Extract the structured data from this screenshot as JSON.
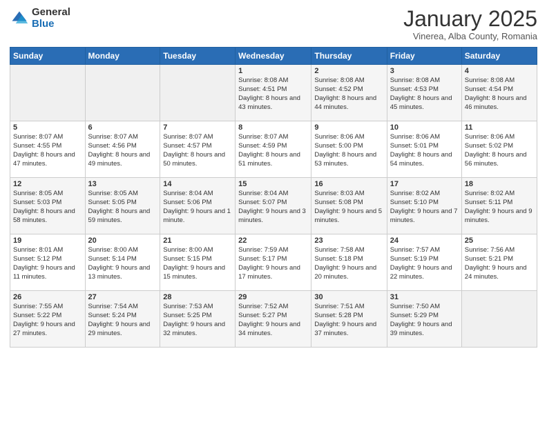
{
  "header": {
    "logo_general": "General",
    "logo_blue": "Blue",
    "month": "January 2025",
    "location": "Vinerea, Alba County, Romania"
  },
  "weekdays": [
    "Sunday",
    "Monday",
    "Tuesday",
    "Wednesday",
    "Thursday",
    "Friday",
    "Saturday"
  ],
  "weeks": [
    [
      {
        "day": "",
        "sunrise": "",
        "sunset": "",
        "daylight": ""
      },
      {
        "day": "",
        "sunrise": "",
        "sunset": "",
        "daylight": ""
      },
      {
        "day": "",
        "sunrise": "",
        "sunset": "",
        "daylight": ""
      },
      {
        "day": "1",
        "sunrise": "Sunrise: 8:08 AM",
        "sunset": "Sunset: 4:51 PM",
        "daylight": "Daylight: 8 hours and 43 minutes."
      },
      {
        "day": "2",
        "sunrise": "Sunrise: 8:08 AM",
        "sunset": "Sunset: 4:52 PM",
        "daylight": "Daylight: 8 hours and 44 minutes."
      },
      {
        "day": "3",
        "sunrise": "Sunrise: 8:08 AM",
        "sunset": "Sunset: 4:53 PM",
        "daylight": "Daylight: 8 hours and 45 minutes."
      },
      {
        "day": "4",
        "sunrise": "Sunrise: 8:08 AM",
        "sunset": "Sunset: 4:54 PM",
        "daylight": "Daylight: 8 hours and 46 minutes."
      }
    ],
    [
      {
        "day": "5",
        "sunrise": "Sunrise: 8:07 AM",
        "sunset": "Sunset: 4:55 PM",
        "daylight": "Daylight: 8 hours and 47 minutes."
      },
      {
        "day": "6",
        "sunrise": "Sunrise: 8:07 AM",
        "sunset": "Sunset: 4:56 PM",
        "daylight": "Daylight: 8 hours and 49 minutes."
      },
      {
        "day": "7",
        "sunrise": "Sunrise: 8:07 AM",
        "sunset": "Sunset: 4:57 PM",
        "daylight": "Daylight: 8 hours and 50 minutes."
      },
      {
        "day": "8",
        "sunrise": "Sunrise: 8:07 AM",
        "sunset": "Sunset: 4:59 PM",
        "daylight": "Daylight: 8 hours and 51 minutes."
      },
      {
        "day": "9",
        "sunrise": "Sunrise: 8:06 AM",
        "sunset": "Sunset: 5:00 PM",
        "daylight": "Daylight: 8 hours and 53 minutes."
      },
      {
        "day": "10",
        "sunrise": "Sunrise: 8:06 AM",
        "sunset": "Sunset: 5:01 PM",
        "daylight": "Daylight: 8 hours and 54 minutes."
      },
      {
        "day": "11",
        "sunrise": "Sunrise: 8:06 AM",
        "sunset": "Sunset: 5:02 PM",
        "daylight": "Daylight: 8 hours and 56 minutes."
      }
    ],
    [
      {
        "day": "12",
        "sunrise": "Sunrise: 8:05 AM",
        "sunset": "Sunset: 5:03 PM",
        "daylight": "Daylight: 8 hours and 58 minutes."
      },
      {
        "day": "13",
        "sunrise": "Sunrise: 8:05 AM",
        "sunset": "Sunset: 5:05 PM",
        "daylight": "Daylight: 8 hours and 59 minutes."
      },
      {
        "day": "14",
        "sunrise": "Sunrise: 8:04 AM",
        "sunset": "Sunset: 5:06 PM",
        "daylight": "Daylight: 9 hours and 1 minute."
      },
      {
        "day": "15",
        "sunrise": "Sunrise: 8:04 AM",
        "sunset": "Sunset: 5:07 PM",
        "daylight": "Daylight: 9 hours and 3 minutes."
      },
      {
        "day": "16",
        "sunrise": "Sunrise: 8:03 AM",
        "sunset": "Sunset: 5:08 PM",
        "daylight": "Daylight: 9 hours and 5 minutes."
      },
      {
        "day": "17",
        "sunrise": "Sunrise: 8:02 AM",
        "sunset": "Sunset: 5:10 PM",
        "daylight": "Daylight: 9 hours and 7 minutes."
      },
      {
        "day": "18",
        "sunrise": "Sunrise: 8:02 AM",
        "sunset": "Sunset: 5:11 PM",
        "daylight": "Daylight: 9 hours and 9 minutes."
      }
    ],
    [
      {
        "day": "19",
        "sunrise": "Sunrise: 8:01 AM",
        "sunset": "Sunset: 5:12 PM",
        "daylight": "Daylight: 9 hours and 11 minutes."
      },
      {
        "day": "20",
        "sunrise": "Sunrise: 8:00 AM",
        "sunset": "Sunset: 5:14 PM",
        "daylight": "Daylight: 9 hours and 13 minutes."
      },
      {
        "day": "21",
        "sunrise": "Sunrise: 8:00 AM",
        "sunset": "Sunset: 5:15 PM",
        "daylight": "Daylight: 9 hours and 15 minutes."
      },
      {
        "day": "22",
        "sunrise": "Sunrise: 7:59 AM",
        "sunset": "Sunset: 5:17 PM",
        "daylight": "Daylight: 9 hours and 17 minutes."
      },
      {
        "day": "23",
        "sunrise": "Sunrise: 7:58 AM",
        "sunset": "Sunset: 5:18 PM",
        "daylight": "Daylight: 9 hours and 20 minutes."
      },
      {
        "day": "24",
        "sunrise": "Sunrise: 7:57 AM",
        "sunset": "Sunset: 5:19 PM",
        "daylight": "Daylight: 9 hours and 22 minutes."
      },
      {
        "day": "25",
        "sunrise": "Sunrise: 7:56 AM",
        "sunset": "Sunset: 5:21 PM",
        "daylight": "Daylight: 9 hours and 24 minutes."
      }
    ],
    [
      {
        "day": "26",
        "sunrise": "Sunrise: 7:55 AM",
        "sunset": "Sunset: 5:22 PM",
        "daylight": "Daylight: 9 hours and 27 minutes."
      },
      {
        "day": "27",
        "sunrise": "Sunrise: 7:54 AM",
        "sunset": "Sunset: 5:24 PM",
        "daylight": "Daylight: 9 hours and 29 minutes."
      },
      {
        "day": "28",
        "sunrise": "Sunrise: 7:53 AM",
        "sunset": "Sunset: 5:25 PM",
        "daylight": "Daylight: 9 hours and 32 minutes."
      },
      {
        "day": "29",
        "sunrise": "Sunrise: 7:52 AM",
        "sunset": "Sunset: 5:27 PM",
        "daylight": "Daylight: 9 hours and 34 minutes."
      },
      {
        "day": "30",
        "sunrise": "Sunrise: 7:51 AM",
        "sunset": "Sunset: 5:28 PM",
        "daylight": "Daylight: 9 hours and 37 minutes."
      },
      {
        "day": "31",
        "sunrise": "Sunrise: 7:50 AM",
        "sunset": "Sunset: 5:29 PM",
        "daylight": "Daylight: 9 hours and 39 minutes."
      },
      {
        "day": "",
        "sunrise": "",
        "sunset": "",
        "daylight": ""
      }
    ]
  ]
}
